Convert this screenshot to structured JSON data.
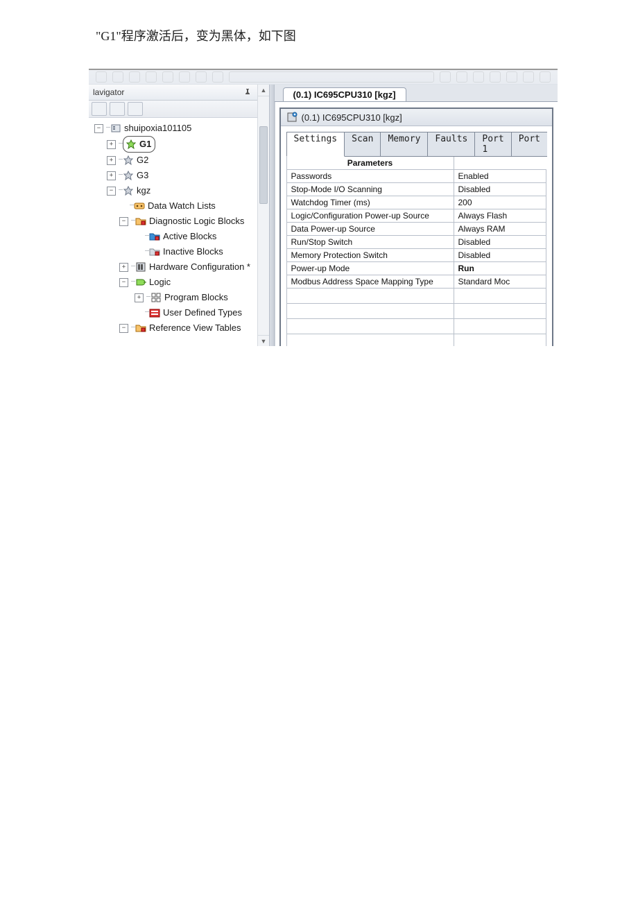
{
  "caption": "\"G1\"程序激活后，变为黑体，如下图",
  "navigator": {
    "title": "lavigator",
    "project": "shuipoxia101105",
    "targets": {
      "g1": "G1",
      "g2": "G2",
      "g3": "G3",
      "kgz": "kgz"
    },
    "nodes": {
      "dataWatch": "Data Watch Lists",
      "diagLogic": "Diagnostic Logic Blocks",
      "activeBlocks": "Active Blocks",
      "inactiveBlocks": "Inactive Blocks",
      "hwConfig": "Hardware Configuration *",
      "logic": "Logic",
      "programBlocks": "Program Blocks",
      "userDefTypes": "User Defined Types",
      "refViewTables": "Reference View Tables"
    }
  },
  "docTab": "(0.1) IC695CPU310 [kgz]",
  "inspectorTitle": "(0.1) IC695CPU310 [kgz]",
  "innerTabs": [
    "Settings",
    "Scan",
    "Memory",
    "Faults",
    "Port 1",
    "Port"
  ],
  "paramsHeader": "Parameters",
  "params": [
    {
      "name": "Passwords",
      "value": "Enabled"
    },
    {
      "name": "Stop-Mode I/O Scanning",
      "value": "Disabled"
    },
    {
      "name": "Watchdog Timer (ms)",
      "value": "200"
    },
    {
      "name": "Logic/Configuration Power-up Source",
      "value": "Always Flash"
    },
    {
      "name": "Data Power-up Source",
      "value": "Always RAM"
    },
    {
      "name": "Run/Stop Switch",
      "value": "Disabled"
    },
    {
      "name": "Memory Protection Switch",
      "value": "Disabled"
    },
    {
      "name": "Power-up Mode",
      "value": "Run",
      "bold": true
    },
    {
      "name": "Modbus Address Space Mapping Type",
      "value": "Standard Moc"
    }
  ]
}
